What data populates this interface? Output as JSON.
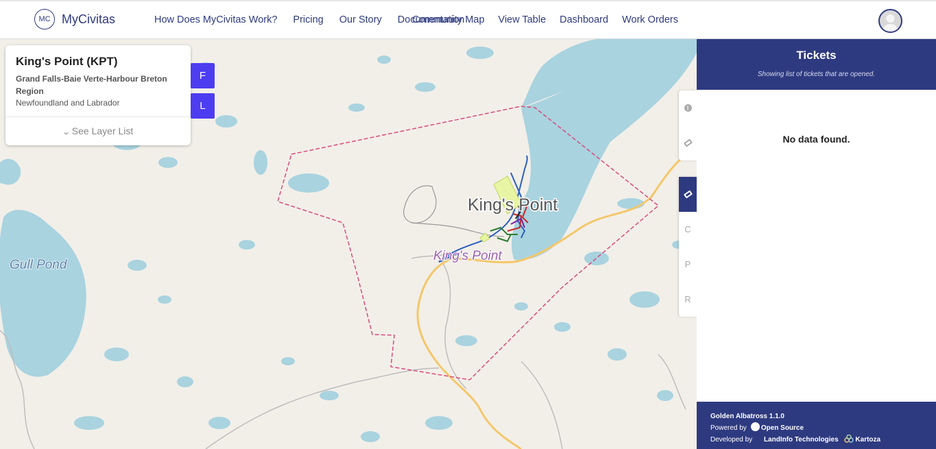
{
  "brand": {
    "logo": "MC",
    "name": "MyCivitas"
  },
  "nav": {
    "left": [
      "How Does MyCivitas Work?",
      "Pricing",
      "Our Story",
      "Documentation"
    ],
    "right": [
      "Community Map",
      "View Table",
      "Dashboard",
      "Work Orders"
    ]
  },
  "info": {
    "title": "King's Point (KPT)",
    "region": "Grand Falls-Baie Verte-Harbour Breton Region",
    "province": "Newfoundland and Labrador",
    "layer_link": "See Layer List"
  },
  "buttons": {
    "f": "F",
    "l": "L"
  },
  "tools": {
    "group1": [
      "info-circle-icon",
      "tag-icon"
    ],
    "group2": [
      "ticket-icon",
      "C",
      "P",
      "R"
    ]
  },
  "map": {
    "labels": {
      "place_large": "King's Point",
      "place_small": "King's Point",
      "lake": "Gull Pond"
    },
    "colors": {
      "water": "#a9d3df",
      "land": "#f2efe9",
      "boundary": "#d94b7a",
      "road": "#f5c76a"
    }
  },
  "tickets": {
    "title": "Tickets",
    "subtitle": "Showing list of tickets that are opened.",
    "empty": "No data found."
  },
  "footer": {
    "version": "Golden Albatross 1.1.0",
    "powered_by": "Powered by",
    "open_source": "Open Source",
    "developed_by": "Developed by",
    "dev1": "LandInfo Technologies",
    "dev2": "Kartoza"
  },
  "accent": "#2e3a80",
  "button_color": "#4d3df0"
}
